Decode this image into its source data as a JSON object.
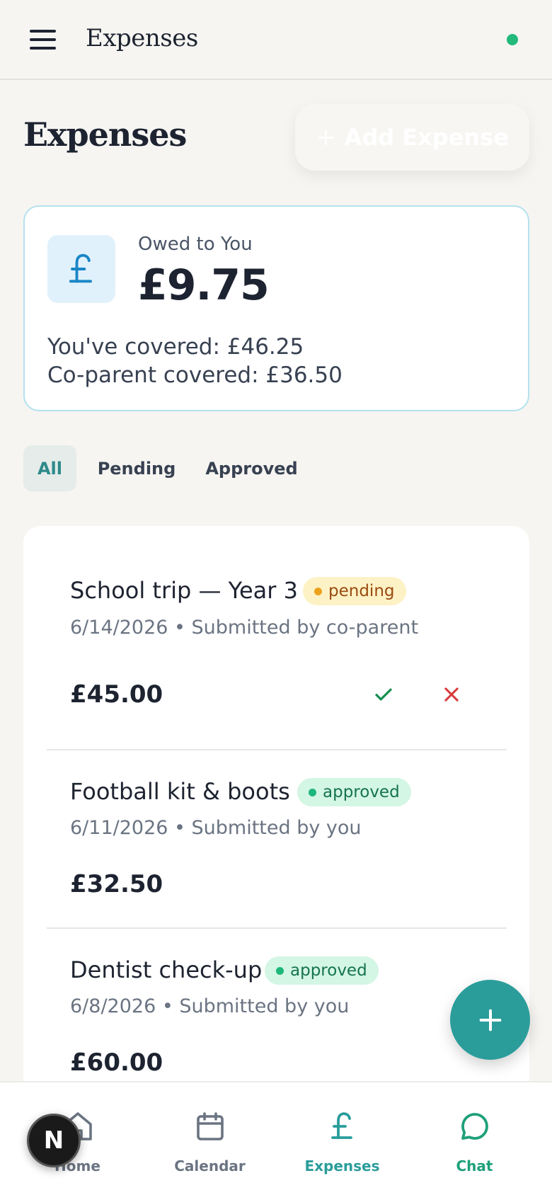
{
  "header": {
    "title": "Expenses",
    "status_color": "#22b97a"
  },
  "page": {
    "title": "Expenses",
    "add_button_icon": "+",
    "add_button_label": "Add Expense"
  },
  "balance": {
    "icon": "pound-icon",
    "owed_label": "Owed to You",
    "owed_amount": "£9.75",
    "you_covered": "You've covered: £46.25",
    "coparent_covered": "Co-parent covered: £36.50"
  },
  "filters": {
    "tabs": [
      {
        "label": "All",
        "active": true
      },
      {
        "label": "Pending",
        "active": false
      },
      {
        "label": "Approved",
        "active": false
      }
    ]
  },
  "expenses": [
    {
      "title": "School trip — Year 3",
      "status": "pending",
      "meta": "6/14/2026 • Submitted by co-parent",
      "amount": "£45.00",
      "actions": [
        "approve-check-icon",
        "reject-x-icon"
      ]
    },
    {
      "title": "Football kit & boots",
      "status": "approved",
      "meta": "6/11/2026 • Submitted by you",
      "amount": "£32.50"
    },
    {
      "title": "Dentist check-up",
      "status": "approved",
      "meta": "6/8/2026 • Submitted by you",
      "amount": "£60.00"
    }
  ],
  "fab": {
    "icon": "plus-icon"
  },
  "nav": {
    "items": [
      {
        "label": "Home",
        "icon": "home-icon"
      },
      {
        "label": "Calendar",
        "icon": "calendar-icon"
      },
      {
        "label": "Expenses",
        "icon": "pound-icon",
        "active": true
      },
      {
        "label": "Chat",
        "icon": "chat-bubble-icon"
      }
    ]
  },
  "avatar": {
    "initial": "N"
  },
  "colors": {
    "accent": "#2a9d9b",
    "pending": "#eba21d",
    "approved": "#1db77a",
    "reject": "#d93a3a"
  }
}
